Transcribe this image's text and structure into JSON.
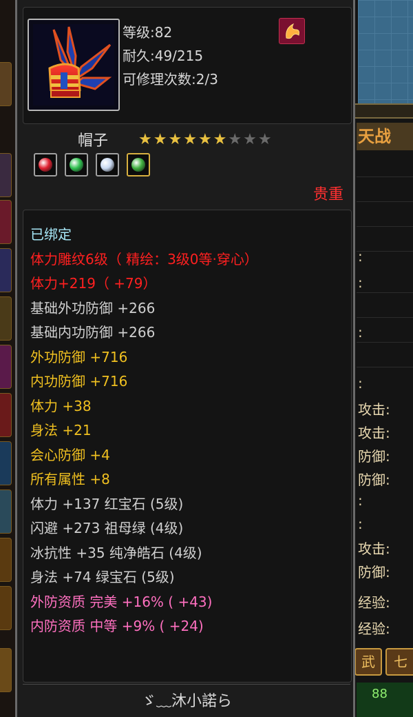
{
  "item": {
    "level": "等级:82",
    "durability": "耐久:49/215",
    "repair_count": "可修理次数:2/3",
    "badge_icon": "phoenix-badge-icon",
    "icon": "hat-icon",
    "name": "帽子",
    "stars_filled": 6,
    "stars_total": 9,
    "rarity": "贵重",
    "gem_slots": [
      {
        "icon": "red-gem-icon",
        "color": "#e02030"
      },
      {
        "icon": "green-gem-icon",
        "color": "#30c050"
      },
      {
        "icon": "white-gem-icon",
        "color": "#c8d8f0"
      },
      {
        "icon": "green-gem-icon",
        "color": "#40b040"
      }
    ]
  },
  "stats": [
    {
      "text": "已绑定",
      "color": "cyan"
    },
    {
      "text": "体力雕纹6级（ 精绘：3级0等·穿心）",
      "color": "red"
    },
    {
      "text": "体力+219（ +79）",
      "color": "red"
    },
    {
      "text": "基础外功防御 +266",
      "color": "gray"
    },
    {
      "text": "基础内功防御 +266",
      "color": "gray"
    },
    {
      "text": "外功防御 +716",
      "color": "gold"
    },
    {
      "text": "内功防御 +716",
      "color": "gold"
    },
    {
      "text": "体力 +38",
      "color": "gold"
    },
    {
      "text": "身法 +21",
      "color": "gold"
    },
    {
      "text": "会心防御 +4",
      "color": "gold"
    },
    {
      "text": "所有属性 +8",
      "color": "gold"
    },
    {
      "text": "体力 +137 红宝石 (5级)",
      "color": "gray"
    },
    {
      "text": "闪避 +273 祖母绿 (4级)",
      "color": "gray"
    },
    {
      "text": "冰抗性 +35 纯净皓石 (4级)",
      "color": "gray"
    },
    {
      "text": "身法 +74 绿宝石 (5级)",
      "color": "gray"
    },
    {
      "text": "外防资质  完美 +16% ( +43)",
      "color": "pink"
    },
    {
      "text": "内防资质  中等 +9% ( +24)",
      "color": "pink"
    }
  ],
  "footer": {
    "owner": "ゞ﹏沐小諾ら"
  },
  "background": {
    "banner": "天战",
    "labels": [
      ":",
      ":",
      ":",
      ":",
      "攻击:",
      "攻击:",
      "防御:",
      "防御:",
      ":",
      ":",
      "攻击:",
      "防御:",
      "经验:",
      "经验:"
    ],
    "btn1": "武",
    "btn2": "七",
    "green_number": "88"
  }
}
